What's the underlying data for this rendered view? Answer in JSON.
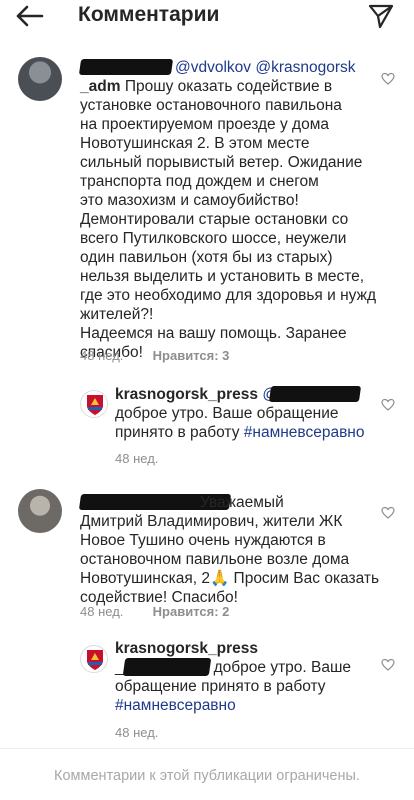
{
  "header": {
    "title": "Комментарии",
    "back_icon": "back-arrow-icon",
    "send_icon": "send-icon"
  },
  "comments": [
    {
      "username_visible": "_adm",
      "mentions": "@vdvolkov @krasnogorsk",
      "lines": [
        "Прошу оказать содействие в",
        "установке остановочного павильона",
        "на проектируемом проезде у дома",
        "Новотушинская 2. В этом месте",
        "сильный порывистый ветер. Ожидание",
        "транспорта под дождем и снегом",
        "это мазохизм и самоубийство!",
        "Демонтировали старые остановки со",
        "всего Путилковского шоссе, неужели",
        "один павильон (хотя бы из старых)",
        "нельзя выделить и установить в месте,",
        "где это необходимо для здоровья и нужд",
        "жителей?!",
        "Надеемся на вашу помощь. Заранее",
        "спасибо!"
      ],
      "time": "48 нед.",
      "likes": "Нравится: 3",
      "reply": {
        "username": "krasnogorsk_press",
        "mention_prefix": "@",
        "text_line1": "доброе утро. Ваше обращение",
        "text_line2": "принято в работу",
        "hashtag": "#намневсеравно",
        "time": "48 нед."
      }
    },
    {
      "line1_text": "Уважаемый",
      "lines": [
        "Дмитрий Владимирович, жители ЖК",
        "Новое Тушино очень нуждаются в",
        "остановочном павильоне возле дома",
        "Новотушинская, 2🙏 Просим Вас оказать",
        "содействие! Спасибо!"
      ],
      "time": "48 нед.",
      "likes": "Нравится: 2",
      "reply": {
        "username": "krasnogorsk_press",
        "prefix": "_",
        "text_line1": "доброе утро. Ваше",
        "text_line2": "обращение принято в работу",
        "hashtag": "#намневсеравно",
        "time": "48 нед."
      }
    }
  ],
  "footer": {
    "text": "Комментарии к этой публикации ограничены."
  },
  "colors": {
    "text": "#262626",
    "meta": "#8e8e8e",
    "link": "#1e3a8a",
    "footer": "#a8a8a8"
  }
}
